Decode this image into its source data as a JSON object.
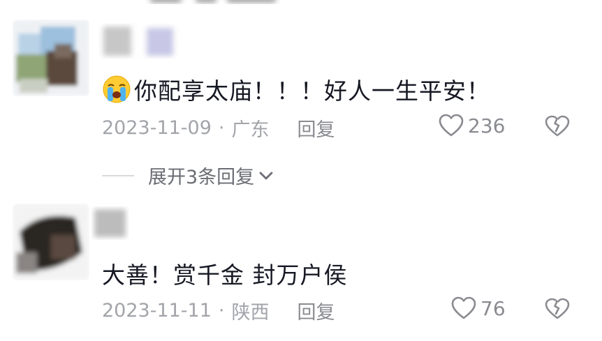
{
  "comments": [
    {
      "text": "你配享太庙！！！好人一生平安！",
      "emoji": "loudly-crying-face",
      "date": "2023-11-09",
      "separator": "·",
      "location": "广东",
      "reply_label": "回复",
      "likes": "236",
      "expand_replies_label": "展开3条回复"
    },
    {
      "text": "大善！赏千金 封万户侯",
      "date": "2023-11-11",
      "separator": "·",
      "location": "陕西",
      "reply_label": "回复",
      "likes": "76"
    }
  ],
  "icons": {
    "like": "heart-outline-icon",
    "dislike": "broken-heart-outline-icon",
    "expand": "chevron-down-icon"
  },
  "colors": {
    "text_primary": "#161823",
    "text_meta": "#a2a4aa",
    "text_action": "#8a8b91"
  }
}
